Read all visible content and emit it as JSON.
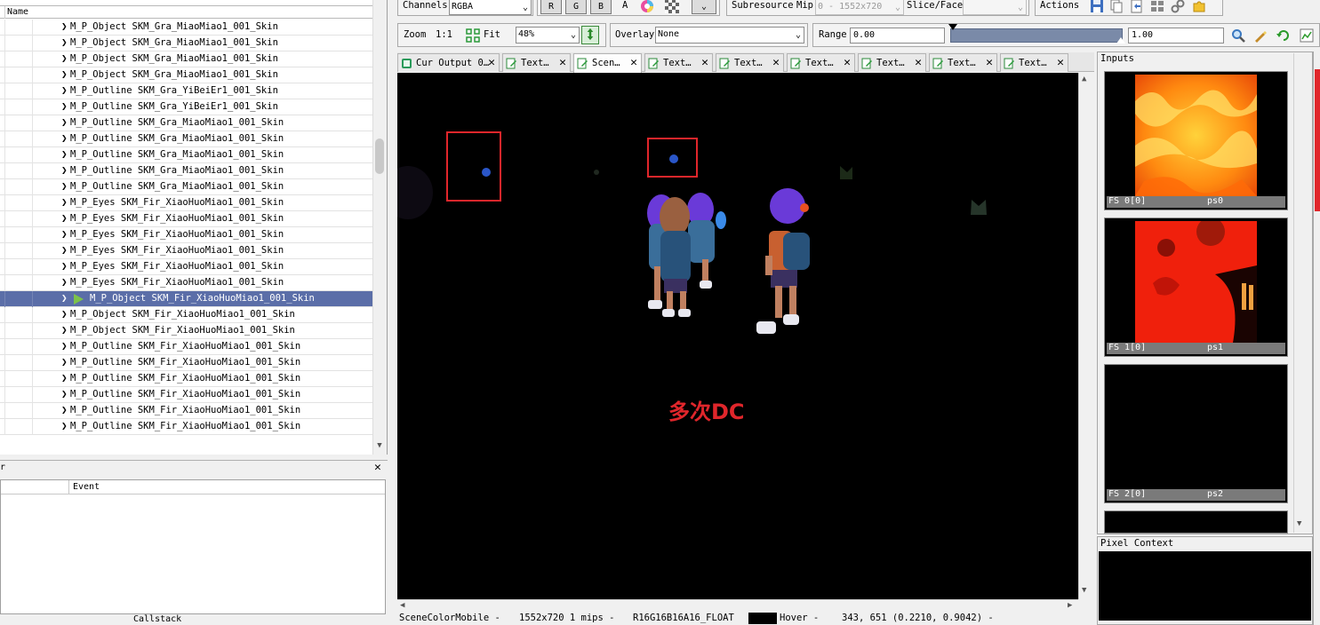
{
  "event_tree": {
    "column_header": "Name",
    "rows": [
      "M_P_Object SKM_Gra_MiaoMiao1_001_Skin",
      "M_P_Object SKM_Gra_MiaoMiao1_001_Skin",
      "M_P_Object SKM_Gra_MiaoMiao1_001_Skin",
      "M_P_Object SKM_Gra_MiaoMiao1_001_Skin",
      "M_P_Outline SKM_Gra_YiBeiEr1_001_Skin",
      "M_P_Outline SKM_Gra_YiBeiEr1_001_Skin",
      "M_P_Outline SKM_Gra_MiaoMiao1_001_Skin",
      "M_P_Outline SKM_Gra_MiaoMiao1_001_Skin",
      "M_P_Outline SKM_Gra_MiaoMiao1_001_Skin",
      "M_P_Outline SKM_Gra_MiaoMiao1_001_Skin",
      "M_P_Outline SKM_Gra_MiaoMiao1_001_Skin",
      "M_P_Eyes SKM_Fir_XiaoHuoMiao1_001_Skin",
      "M_P_Eyes SKM_Fir_XiaoHuoMiao1_001_Skin",
      "M_P_Eyes SKM_Fir_XiaoHuoMiao1_001_Skin",
      "M_P_Eyes SKM_Fir_XiaoHuoMiao1_001_Skin",
      "M_P_Eyes SKM_Fir_XiaoHuoMiao1_001_Skin",
      "M_P_Eyes SKM_Fir_XiaoHuoMiao1_001_Skin",
      "M_P_Object SKM_Fir_XiaoHuoMiao1_001_Skin",
      "M_P_Object SKM_Fir_XiaoHuoMiao1_001_Skin",
      "M_P_Object SKM_Fir_XiaoHuoMiao1_001_Skin",
      "M_P_Outline SKM_Fir_XiaoHuoMiao1_001_Skin",
      "M_P_Outline SKM_Fir_XiaoHuoMiao1_001_Skin",
      "M_P_Outline SKM_Fir_XiaoHuoMiao1_001_Skin",
      "M_P_Outline SKM_Fir_XiaoHuoMiao1_001_Skin",
      "M_P_Outline SKM_Fir_XiaoHuoMiao1_001_Skin",
      "M_P_Outline SKM_Fir_XiaoHuoMiao1_001_Skin"
    ],
    "selected_index": 17
  },
  "callstack": {
    "header_label": "r",
    "column_event": "Event",
    "panel_label": "Callstack"
  },
  "toolbar": {
    "channels_label": "Channels",
    "channels_value": "RGBA",
    "r": "R",
    "g": "G",
    "b": "B",
    "a": "A",
    "subresource_label": "Subresource",
    "mip_label": "Mip",
    "mip_value": "0 - 1552x720",
    "slice_label": "Slice/Face",
    "slice_value": "",
    "actions_label": "Actions",
    "zoom_label": "Zoom",
    "zoom_1to1": "1:1",
    "fit_label": "Fit",
    "zoom_value": "48%",
    "overlay_label": "Overlay",
    "overlay_value": "None",
    "range_label": "Range",
    "range_min": "0.00",
    "range_max": "1.00"
  },
  "tabs": [
    {
      "label": "Cur Output 0…",
      "icon": "output-icon",
      "active": false
    },
    {
      "label": "Text…",
      "icon": "texture-icon",
      "active": false
    },
    {
      "label": "Scen…",
      "icon": "texture-icon",
      "active": true
    },
    {
      "label": "Text…",
      "icon": "texture-icon",
      "active": false
    },
    {
      "label": "Text…",
      "icon": "texture-icon",
      "active": false
    },
    {
      "label": "Text…",
      "icon": "texture-icon",
      "active": false
    },
    {
      "label": "Text…",
      "icon": "texture-icon",
      "active": false
    },
    {
      "label": "Text…",
      "icon": "texture-icon",
      "active": false
    },
    {
      "label": "Text…",
      "icon": "texture-icon",
      "active": false
    }
  ],
  "viewport": {
    "annotation": "多次DC",
    "annotation_color": "#e0262b"
  },
  "status": {
    "texture": "SceneColorMobile -",
    "size": "1552x720 1 mips -",
    "format": "R16G16B16A16_FLOAT",
    "hover": "Hover -",
    "coords": "343,  651 (0.2210, 0.9042)  -"
  },
  "inputs": {
    "title": "Inputs",
    "items": [
      {
        "slot": "FS 0[0]",
        "name": "ps0"
      },
      {
        "slot": "FS 1[0]",
        "name": "ps1"
      },
      {
        "slot": "FS 2[0]",
        "name": "ps2"
      }
    ]
  },
  "pixel_context": {
    "title": "Pixel Context"
  },
  "colors": {
    "selection": "#5b6ea8",
    "highlight_red": "#e0262b"
  }
}
